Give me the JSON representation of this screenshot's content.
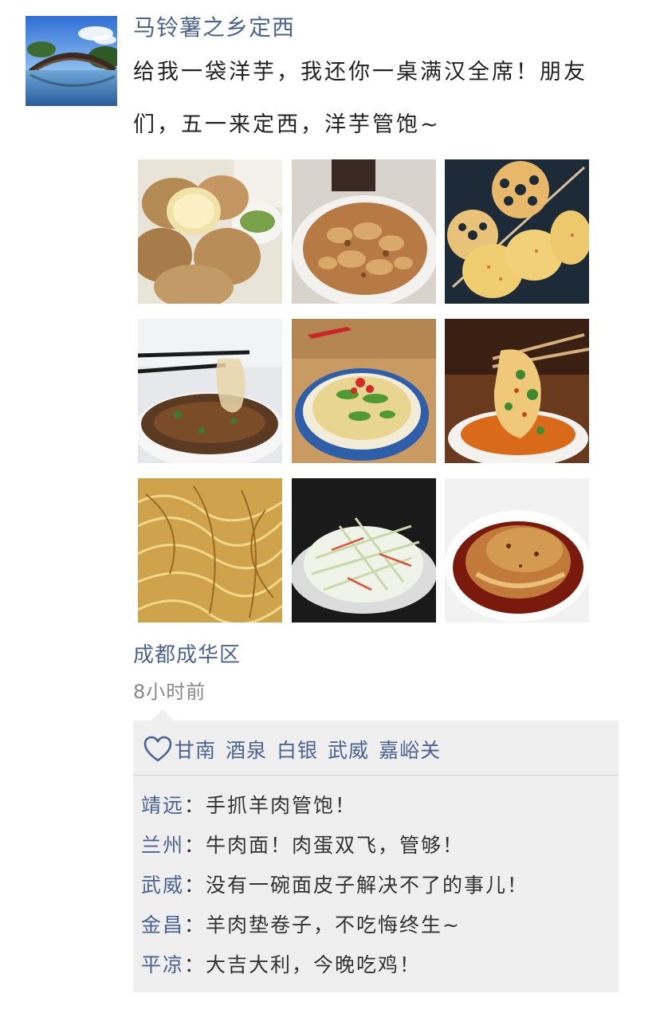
{
  "post": {
    "username": "马铃薯之乡定西",
    "text": "给我一袋洋芋，我还你一桌满汉全席！朋友们，五一来定西，洋芋管饱~",
    "location": "成都成华区",
    "time": "8小时前"
  },
  "photos": [
    {
      "name": "baked-potatoes-photo",
      "subject": "baked potatoes"
    },
    {
      "name": "fried-potato-slices-photo",
      "subject": "stir-fried potato slices"
    },
    {
      "name": "lotus-potato-skewers-photo",
      "subject": "grilled lotus root and potato skewers"
    },
    {
      "name": "potato-noodles-chopsticks-photo",
      "subject": "potato noodles with chopsticks"
    },
    {
      "name": "mashed-potato-chili-photo",
      "subject": "potato dish with chili and cilantro"
    },
    {
      "name": "spicy-potato-chopsticks-photo",
      "subject": "spicy potato pieces with chopsticks"
    },
    {
      "name": "crispy-shredded-potato-photo",
      "subject": "crispy fried shredded potato"
    },
    {
      "name": "shredded-potato-salad-photo",
      "subject": "cold shredded potato salad"
    },
    {
      "name": "braised-potato-red-oil-photo",
      "subject": "braised potato in red oil"
    }
  ],
  "likes": [
    "甘南",
    "酒泉",
    "白银",
    "武威",
    "嘉峪关"
  ],
  "comments": [
    {
      "name": "靖远",
      "sep": "：",
      "text": "手抓羊肉管饱！"
    },
    {
      "name": "兰州",
      "sep": "：",
      "text": "牛肉面！肉蛋双飞，管够！"
    },
    {
      "name": "武威",
      "sep": "：",
      "text": "没有一碗面皮子解决不了的事儿！"
    },
    {
      "name": "金昌",
      "sep": "：",
      "text": "羊肉垫卷子，不吃悔终生~"
    },
    {
      "name": "平凉",
      "sep": "：",
      "text": "大吉大利，今晚吃鸡！"
    }
  ],
  "colors": {
    "link": "#4a6390",
    "text": "#222222",
    "meta": "#888888",
    "comment_bg": "#efefef"
  }
}
